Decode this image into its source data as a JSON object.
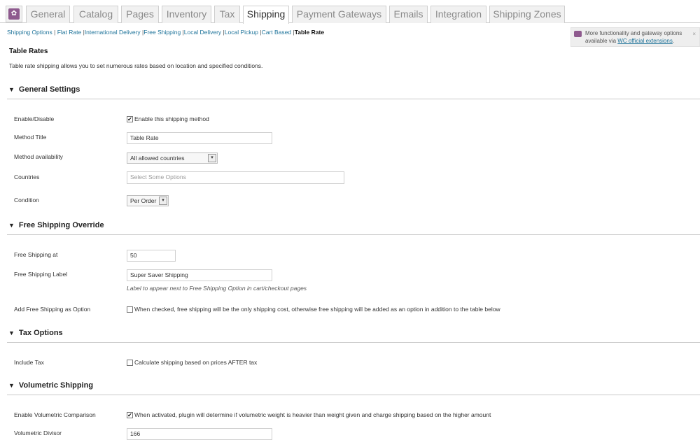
{
  "tabs": {
    "logo_glyph": "✿",
    "items": [
      "General",
      "Catalog",
      "Pages",
      "Inventory",
      "Tax",
      "Shipping",
      "Payment Gateways",
      "Emails",
      "Integration",
      "Shipping Zones"
    ],
    "active": "Shipping"
  },
  "subnav": {
    "links": [
      "Shipping Options",
      "Flat Rate",
      "International Delivery",
      "Free Shipping",
      "Local Delivery",
      "Local Pickup",
      "Cart Based"
    ],
    "separator": "|",
    "current": "Table Rate"
  },
  "notice": {
    "text": "More functionality and gateway options available via",
    "link": "WC official extensions",
    "suffix": ".",
    "close": "×"
  },
  "page": {
    "title": "Table Rates",
    "description": "Table rate shipping allows you to set numerous rates based on location and specified conditions."
  },
  "sections": {
    "general": {
      "title": "General Settings",
      "enable_label": "Enable/Disable",
      "enable_text": "Enable this shipping method",
      "enable_checked": true,
      "method_title_label": "Method Title",
      "method_title_value": "Table Rate",
      "availability_label": "Method availability",
      "availability_value": "All allowed countries",
      "countries_label": "Countries",
      "countries_placeholder": "Select Some Options",
      "condition_label": "Condition",
      "condition_value": "Per Order"
    },
    "free_shipping": {
      "title": "Free Shipping Override",
      "at_label": "Free Shipping at",
      "at_value": "50",
      "label_label": "Free Shipping Label",
      "label_value": "Super Saver Shipping",
      "label_help": "Label to appear next to Free Shipping Option in cart/checkout pages",
      "add_label": "Add Free Shipping as Option",
      "add_text": "When checked, free shipping will be the only shipping cost, otherwise free shipping will be added as an option in addition to the table below",
      "add_checked": false
    },
    "tax": {
      "title": "Tax Options",
      "include_label": "Include Tax",
      "include_text": "Calculate shipping based on prices AFTER tax",
      "include_checked": false
    },
    "volumetric": {
      "title": "Volumetric Shipping",
      "compare_label": "Enable Volumetric Comparison",
      "compare_text": "When activated, plugin will determine if volumetric weight is heavier than weight given and charge shipping based on the higher amount",
      "compare_checked": true,
      "divisor_label": "Volumetric Divisor",
      "divisor_value": "166"
    }
  },
  "glyphs": {
    "triangle": "▼",
    "check": "✔",
    "select_arrow": "▾"
  }
}
